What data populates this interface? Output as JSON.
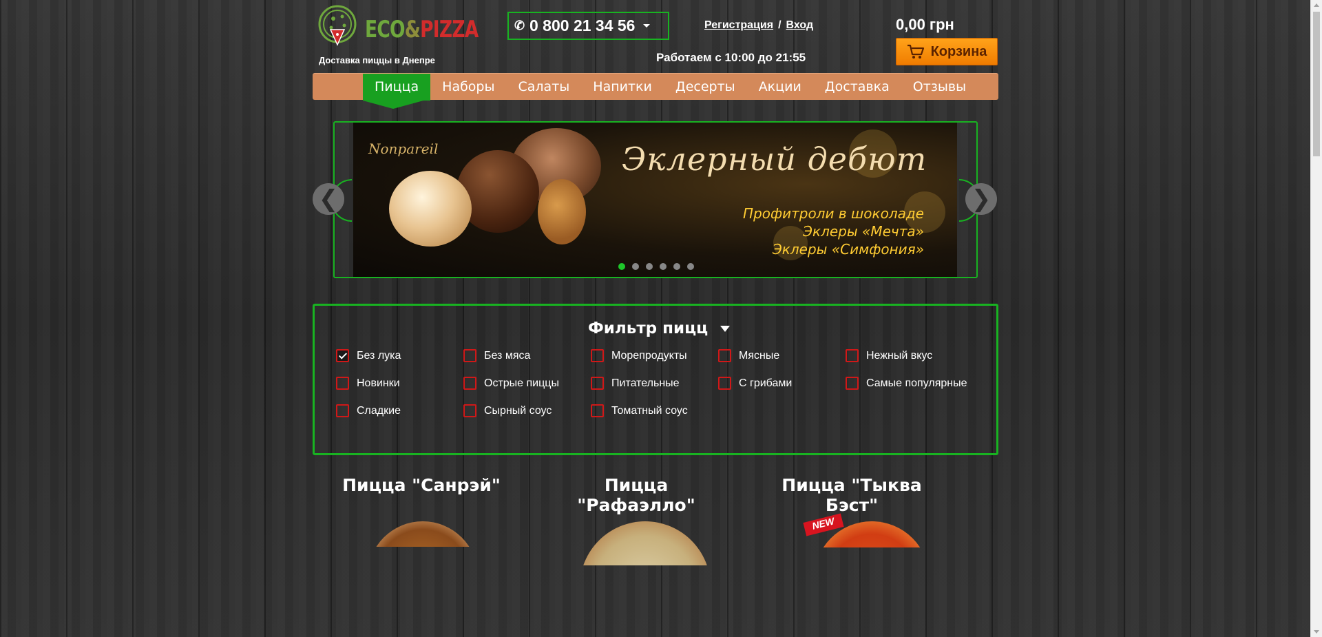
{
  "header": {
    "logo_eco": "ECO",
    "logo_amp": "&",
    "logo_pizza": "PIZZA",
    "tagline": "Доставка пиццы в Днепре",
    "phone": "0 800 21 34 56",
    "register": "Регистрация",
    "separator": "/",
    "login": "Вход",
    "hours": "Работаем с 10:00 до 21:55",
    "price": "0,00 грн",
    "cart": "Корзина"
  },
  "menu": {
    "items": [
      "Пицца",
      "Наборы",
      "Салаты",
      "Напитки",
      "Десерты",
      "Акции",
      "Доставка",
      "Отзывы"
    ],
    "active_index": 0
  },
  "slider": {
    "brand": "Nonpareil",
    "headline": "Эклерный дебют",
    "lines": [
      "Профитроли в шоколаде",
      "Эклеры «Мечта»",
      "Эклеры «Симфония»"
    ],
    "prev": "❮",
    "next": "❯",
    "dot_count": 6,
    "active_dot": 0
  },
  "filter": {
    "title": "Фильтр пицц",
    "options": [
      {
        "label": "Без лука",
        "checked": true
      },
      {
        "label": "Без мяса",
        "checked": false
      },
      {
        "label": "Морепродукты",
        "checked": false
      },
      {
        "label": "Мясные",
        "checked": false
      },
      {
        "label": "Нежный вкус",
        "checked": false
      },
      {
        "label": "Новинки",
        "checked": false
      },
      {
        "label": "Острые пиццы",
        "checked": false
      },
      {
        "label": "Питательные",
        "checked": false
      },
      {
        "label": "С грибами",
        "checked": false
      },
      {
        "label": "Самые популярные",
        "checked": false
      },
      {
        "label": "Сладкие",
        "checked": false
      },
      {
        "label": "Сырный соус",
        "checked": false
      },
      {
        "label": "Томатный соус",
        "checked": false
      }
    ]
  },
  "products": [
    {
      "title": "Пицца \"Санрэй\""
    },
    {
      "title": "Пицца \"Рафаэлло\""
    },
    {
      "title": "Пицца \"Тыква Бэст\"",
      "badge": "NEW"
    }
  ],
  "colors": {
    "accent_green": "#18b321",
    "menu_bg": "#d4895a",
    "cart_orange": "#f59000",
    "checkbox_red": "#d01818"
  },
  "icons": {
    "phone": "phone-icon",
    "cart": "cart-icon",
    "logo": "pizza-slice-logo-icon"
  }
}
